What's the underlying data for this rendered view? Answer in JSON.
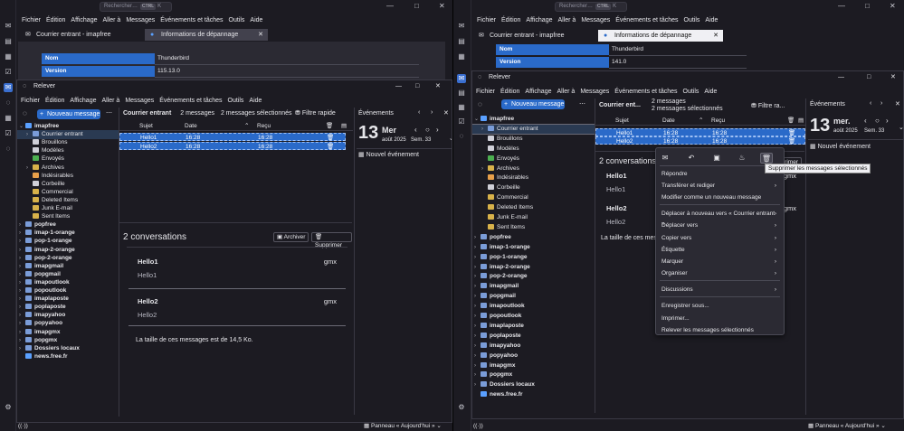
{
  "top": {
    "search_placeholder": "Rechercher…",
    "search_kbd1": "CTRL",
    "search_kbd2": "K",
    "menu": [
      "Fichier",
      "Édition",
      "Affichage",
      "Aller à",
      "Messages",
      "Événements et tâches",
      "Outils",
      "Aide"
    ],
    "tab1": "Courrier entrant - imapfree",
    "tab2": "Informations de dépannage",
    "info_key_name": "Nom",
    "info_val_name": "Thunderbird",
    "info_key_version": "Version",
    "left_version": "115.13.0",
    "right_version": "141.0"
  },
  "relever": {
    "title": "Relever",
    "menu": [
      "Fichier",
      "Édition",
      "Affichage",
      "Aller à",
      "Messages",
      "Événements et tâches",
      "Outils",
      "Aide"
    ],
    "new_message": "Nouveau message",
    "more": "⋯",
    "account_root": "imapfree",
    "imap_folders": [
      "Courrier entrant",
      "Brouillons",
      "Modèles",
      "Envoyés",
      "Archives",
      "Indésirables",
      "Corbeille",
      "Commercial",
      "Deleted Items",
      "Junk E-mail",
      "Sent Items"
    ],
    "accounts": [
      "popfree",
      "imap-1-orange",
      "pop-1-orange",
      "imap-2-orange",
      "pop-2-orange",
      "imapgmail",
      "popgmail",
      "imapoutlook",
      "popoutlook",
      "imaplaposte",
      "poplaposte",
      "imapyahoo",
      "popyahoo",
      "imapgmx",
      "popgmx",
      "Dossiers locaux",
      "news.free.fr"
    ],
    "folder_header_left": "Courrier entrant",
    "folder_header_right": "Courrier ent...",
    "count_messages": "2 messages",
    "count_selected": "2 messages sélectionnés",
    "quick_filter_left": "Filtre rapide",
    "quick_filter_right": "Filtre ra...",
    "col_subject": "Sujet",
    "col_date": "Date",
    "col_received": "Reçu",
    "messages": [
      {
        "subject": "Hello1",
        "date": "16:28",
        "received": "16:28"
      },
      {
        "subject": "Hello2",
        "date": "16:28",
        "received": "16:28"
      }
    ],
    "conversations_title": "2 conversations",
    "archive_button": "Archiver",
    "delete_button": "Supprimer",
    "conversations": [
      {
        "from": "Hello1",
        "subject": "Hello1",
        "account": "gmx"
      },
      {
        "from": "Hello2",
        "subject": "Hello2",
        "account": "gmx"
      }
    ],
    "size_text": "La taille de ces messages est de 14,5 Ko.",
    "right_size_text": "La taille de ces mes",
    "events_title": "Événements",
    "day_number": "13",
    "day_name": "Mer",
    "day_name_right": "mer.",
    "month_year": "août 2025",
    "week": "Sem. 33",
    "new_event": "Nouvel événement",
    "status_panel": "Panneau « Aujourd'hui »"
  },
  "context_menu": {
    "items": [
      {
        "label": "Répondre",
        "arrow": false
      },
      {
        "label": "Transférer et rediger",
        "arrow": true
      },
      {
        "label": "Modifier comme un nouveau message",
        "arrow": false
      },
      {
        "label": "Déplacer à nouveau vers « Courrier entrant »",
        "arrow": true
      },
      {
        "label": "Déplacer vers",
        "arrow": true
      },
      {
        "label": "Copier vers",
        "arrow": true
      },
      {
        "label": "Étiquette",
        "arrow": true
      },
      {
        "label": "Marquer",
        "arrow": true
      },
      {
        "label": "Organiser",
        "arrow": true
      },
      {
        "label": "Discussions",
        "arrow": true
      },
      {
        "label": "Enregistrer sous...",
        "arrow": false
      },
      {
        "label": "Imprimer...",
        "arrow": false
      },
      {
        "label": "Relever les messages sélectionnés",
        "arrow": false
      }
    ],
    "tooltip": "Supprimer les messages sélectionnés"
  },
  "colors": {
    "accent": "#2a6ac9",
    "bg": "#1c1b22",
    "panel": "#2b2a33"
  }
}
